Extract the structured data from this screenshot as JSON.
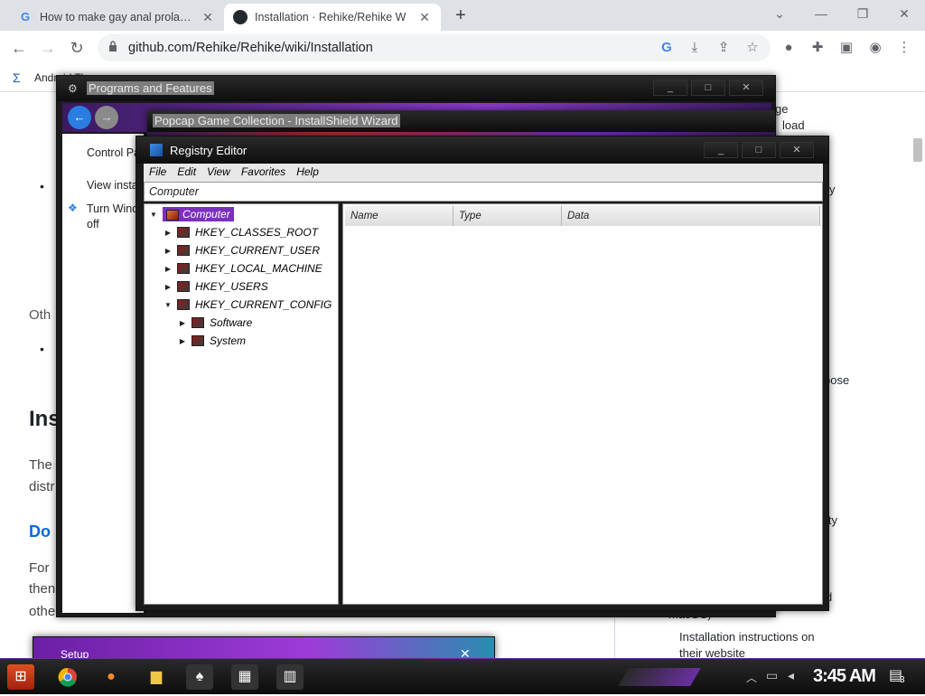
{
  "tabs": [
    {
      "title": "How to make gay anal prolapse",
      "favicon": "google-icon"
    },
    {
      "title": "Installation · Rehike/Rehike W",
      "favicon": "github-icon"
    }
  ],
  "toolbar": {
    "url": "github.com/Rehike/Rehike/wiki/Installation"
  },
  "bookmarks": {
    "item": "Android The..."
  },
  "github": {
    "left_frag": {
      "oth": "Oth",
      "ins": "Ins",
      "the": "The",
      "distr": "distr",
      "do": "Do",
      "for": "For",
      "then": "then",
      "othe": "othe"
    },
    "right_frag": {
      "ge": "ge",
      "load": "load",
      "y": "y",
      "pose": "pose",
      "ity": "ity",
      "ddd": "d",
      "macos": "macOS)",
      "install_text": "Installation instructions on their website"
    }
  },
  "programs": {
    "title": "Programs and Features",
    "control": "Control Pa",
    "view": "View insta",
    "turn": "Turn Wind off"
  },
  "popcap": {
    "title": "Popcap Game Collection - InstallShield Wizard"
  },
  "setup": {
    "title": "Setup"
  },
  "regedit": {
    "title": "Registry Editor",
    "menu": [
      "File",
      "Edit",
      "View",
      "Favorites",
      "Help"
    ],
    "address": "Computer",
    "tree": {
      "root": "Computer",
      "keys": [
        "HKEY_CLASSES_ROOT",
        "HKEY_CURRENT_USER",
        "HKEY_LOCAL_MACHINE",
        "HKEY_USERS",
        "HKEY_CURRENT_CONFIG"
      ],
      "subkeys": [
        "Software",
        "System"
      ]
    },
    "columns": [
      "Name",
      "Type",
      "Data"
    ]
  },
  "taskbar": {
    "clock": "3:45 AM",
    "notifications": "3"
  },
  "colors": {
    "accent": "#7b2fbe",
    "chrome_bg": "#dee1e6"
  }
}
